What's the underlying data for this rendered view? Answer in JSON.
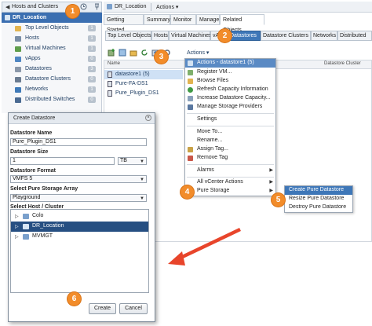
{
  "navigator": {
    "back_glyph": "◀",
    "title": "Hosts and Clusters",
    "selected": "DR_Location",
    "items": [
      {
        "label": "Top Level Objects",
        "count": "1",
        "icon": "folder-icon"
      },
      {
        "label": "Hosts",
        "count": "1",
        "icon": "host-icon"
      },
      {
        "label": "Virtual Machines",
        "count": "1",
        "icon": "vm-icon"
      },
      {
        "label": "vApps",
        "count": "0",
        "icon": "vapp-icon"
      },
      {
        "label": "Datastores",
        "count": "3",
        "icon": "datastore-icon"
      },
      {
        "label": "Datastore Clusters",
        "count": "0",
        "icon": "datastore-cluster-icon"
      },
      {
        "label": "Networks",
        "count": "1",
        "icon": "network-icon"
      },
      {
        "label": "Distributed Switches",
        "count": "0",
        "icon": "dvswitch-icon"
      }
    ]
  },
  "object_header": {
    "title": "DR_Location",
    "actions_label": "Actions ▾"
  },
  "tabs": [
    "Getting Started",
    "Summary",
    "Monitor",
    "Manage",
    "Related Objects"
  ],
  "active_tab": "Related Objects",
  "subtabs": [
    "Top Level Objects",
    "Hosts",
    "Virtual Machines",
    "vApps",
    "Datastores",
    "Datastore Clusters",
    "Networks",
    "Distributed"
  ],
  "active_subtab": "Datastores",
  "toolbar": {
    "actions_label": "Actions ▾"
  },
  "grid": {
    "col_name": "Name",
    "col_type": "Datastore Cluster",
    "rows": [
      "datastore1 (5)",
      "Pure-FA-DS1",
      "Pure_Plugin_DS1"
    ],
    "selected_row": 0
  },
  "actions_menu": {
    "header": "Actions - datastore1 (5)",
    "items": [
      {
        "label": "Register VM...",
        "icon": "register-vm-icon"
      },
      {
        "label": "Browse Files",
        "icon": "browse-files-icon"
      },
      {
        "label": "Refresh Capacity Information",
        "icon": "refresh-icon"
      },
      {
        "label": "Increase Datastore Capacity...",
        "icon": "increase-capacity-icon"
      },
      {
        "label": "Manage Storage Providers",
        "icon": "storage-providers-icon"
      },
      {
        "label": "Settings"
      },
      {
        "label": "Move To..."
      },
      {
        "label": "Rename..."
      },
      {
        "label": "Assign Tag...",
        "icon": "assign-tag-icon"
      },
      {
        "label": "Remove Tag",
        "icon": "remove-tag-icon"
      },
      {
        "label": "Alarms",
        "submenu": true
      },
      {
        "label": "All vCenter Actions",
        "submenu": true
      },
      {
        "label": "Pure Storage",
        "submenu": true
      }
    ]
  },
  "submenu": {
    "items": [
      "Create Pure Datastore",
      "Resize Pure Datastore",
      "Destroy Pure Datastore"
    ],
    "highlighted": 0
  },
  "dialog": {
    "title": "Create Datastore",
    "close_glyph": "×",
    "name_label": "Datastore Name",
    "name_value": "Pure_Plugin_DS1",
    "size_label": "Datastore Size",
    "size_value": "1",
    "size_unit": "TB",
    "format_label": "Datastore Format",
    "format_value": "VMFS 5",
    "array_label": "Select Pure Storage Array",
    "array_value": "Playground",
    "host_label": "Select Host / Cluster",
    "tree": [
      {
        "label": "Colo",
        "toggle": "▷"
      },
      {
        "label": "DR_Location",
        "toggle": "▷",
        "selected": true
      },
      {
        "label": "MVMGT",
        "toggle": "▷"
      }
    ],
    "create_label": "Create",
    "cancel_label": "Cancel"
  },
  "callouts": [
    "1",
    "2",
    "3",
    "4",
    "5",
    "6"
  ],
  "colors": {
    "accent": "#3e77b8",
    "selected": "#264f82",
    "callout": "#f28c2a",
    "arrow": "#e8452b"
  }
}
